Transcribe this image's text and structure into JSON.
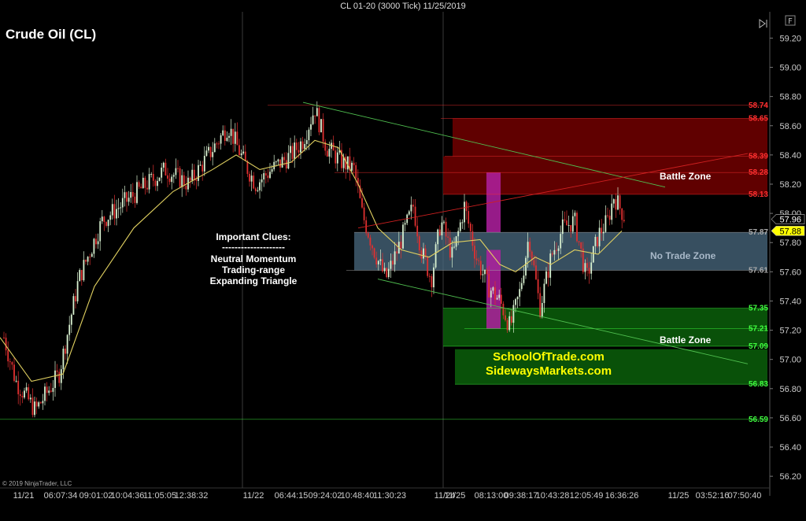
{
  "window": {
    "title": "CL 01-20 (3000 Tick)  11/25/2019",
    "copyright": "© 2019 NinjaTrader, LLC",
    "play_icon": "play-bar-icon",
    "fullscreen_label": "F"
  },
  "colors": {
    "background": "#000000",
    "up_candle": "#d8f0d0",
    "down_candle": "#e03030",
    "moving_average": "#e0d060",
    "resistance_zone": "#6a0000",
    "no_trade_zone": "#4a6a80",
    "support_zone": "#0a5a0a",
    "highlight_bar": "#b020a0"
  },
  "chart_data": {
    "type": "candlestick",
    "title": "Crude Oil (CL)",
    "ylim": [
      56.12,
      59.38
    ],
    "yticks": [
      "59.20",
      "59.00",
      "58.80",
      "58.60",
      "58.40",
      "58.20",
      "58.00",
      "57.80",
      "57.60",
      "57.40",
      "57.20",
      "57.00",
      "56.80",
      "56.60",
      "56.40",
      "56.20"
    ],
    "xticks": [
      "11/21",
      "06:07:34",
      "09:01:02",
      "10:04:36",
      "11:05:05",
      "12:38:32",
      "11/22",
      "06:44:15",
      "09:24:02",
      "10:48:40",
      "11:30:23",
      "11/24",
      "11/25",
      "08:13:00",
      "09:38:17",
      "10:43:28",
      "12:05:49",
      "16:36:26",
      "11/25",
      "03:52:16",
      "07:50:40"
    ],
    "price_path": [
      [
        0,
        57.25
      ],
      [
        20,
        56.85
      ],
      [
        45,
        56.65
      ],
      [
        75,
        56.9
      ],
      [
        100,
        57.55
      ],
      [
        130,
        57.95
      ],
      [
        175,
        58.15
      ],
      [
        210,
        58.3
      ],
      [
        240,
        58.2
      ],
      [
        265,
        58.4
      ],
      [
        290,
        58.6
      ],
      [
        310,
        58.35
      ],
      [
        325,
        58.2
      ],
      [
        345,
        58.3
      ],
      [
        370,
        58.4
      ],
      [
        385,
        58.5
      ],
      [
        400,
        58.72
      ],
      [
        415,
        58.45
      ],
      [
        435,
        58.35
      ],
      [
        450,
        58.3
      ],
      [
        460,
        58.0
      ],
      [
        475,
        57.75
      ],
      [
        490,
        57.55
      ],
      [
        505,
        57.75
      ],
      [
        525,
        58.05
      ],
      [
        535,
        57.75
      ],
      [
        548,
        57.55
      ],
      [
        560,
        57.95
      ],
      [
        575,
        57.7
      ],
      [
        590,
        58.05
      ],
      [
        605,
        57.7
      ],
      [
        620,
        57.5
      ],
      [
        635,
        57.4
      ],
      [
        648,
        57.22
      ],
      [
        660,
        57.45
      ],
      [
        672,
        57.85
      ],
      [
        686,
        57.35
      ],
      [
        700,
        57.7
      ],
      [
        715,
        57.9
      ],
      [
        730,
        57.95
      ],
      [
        745,
        57.55
      ],
      [
        760,
        57.85
      ],
      [
        772,
        57.95
      ],
      [
        780,
        58.12
      ],
      [
        793,
        57.98
      ]
    ],
    "moving_average": [
      [
        0,
        57.15
      ],
      [
        40,
        56.85
      ],
      [
        80,
        56.9
      ],
      [
        120,
        57.5
      ],
      [
        170,
        57.9
      ],
      [
        220,
        58.15
      ],
      [
        270,
        58.3
      ],
      [
        300,
        58.4
      ],
      [
        330,
        58.3
      ],
      [
        370,
        58.35
      ],
      [
        400,
        58.5
      ],
      [
        430,
        58.45
      ],
      [
        455,
        58.2
      ],
      [
        480,
        57.9
      ],
      [
        510,
        57.75
      ],
      [
        545,
        57.7
      ],
      [
        575,
        57.8
      ],
      [
        610,
        57.82
      ],
      [
        635,
        57.65
      ],
      [
        655,
        57.6
      ],
      [
        680,
        57.7
      ],
      [
        700,
        57.65
      ],
      [
        730,
        57.75
      ],
      [
        760,
        57.72
      ],
      [
        790,
        57.88
      ]
    ],
    "trendlines": [
      {
        "from": [
          385,
          58.76
        ],
        "to": [
          845,
          58.18
        ],
        "color": "#50c050"
      },
      {
        "from": [
          480,
          57.55
        ],
        "to": [
          950,
          56.97
        ],
        "color": "#50c050"
      },
      {
        "from": [
          455,
          57.9
        ],
        "to": [
          950,
          58.41
        ],
        "color": "#d02020"
      }
    ],
    "zones": [
      {
        "name": "resistance-zone-upper",
        "y1": 58.65,
        "y2": 58.39,
        "x1": 575,
        "x2": 975
      },
      {
        "name": "resistance-zone-lower",
        "y1": 58.39,
        "y2": 58.13,
        "x1": 563,
        "x2": 975
      },
      {
        "name": "no-trade-zone",
        "y1": 57.87,
        "y2": 57.61,
        "x1": 450,
        "x2": 975
      },
      {
        "name": "support-zone-upper",
        "y1": 57.35,
        "y2": 57.09,
        "x1": 563,
        "x2": 975
      },
      {
        "name": "support-zone-lower",
        "y1": 57.07,
        "y2": 56.83,
        "x1": 578,
        "x2": 975
      }
    ],
    "highlight_bars": [
      {
        "x": 627,
        "y1": 58.28,
        "y2": 57.87
      },
      {
        "x": 627,
        "y1": 57.75,
        "y2": 57.21
      }
    ],
    "price_levels": [
      {
        "value": "58.74",
        "color": "#ff3030",
        "line_from": 340
      },
      {
        "value": "58.65",
        "color": "#ff3030",
        "line_from": 560
      },
      {
        "value": "58.39",
        "color": "#ff3030",
        "line_from": 565
      },
      {
        "value": "58.28",
        "color": "#ff3030",
        "line_from": 425
      },
      {
        "value": "58.13",
        "color": "#ff3030",
        "line_from": 563
      },
      {
        "value": "57.87",
        "color": "#aaaaaa",
        "line_from": 450
      },
      {
        "value": "57.61",
        "color": "#aaaaaa",
        "line_from": 440
      },
      {
        "value": "57.35",
        "color": "#40ff40",
        "line_from": 563
      },
      {
        "value": "57.21",
        "color": "#40ff40",
        "line_from": 590
      },
      {
        "value": "57.09",
        "color": "#40ff40",
        "line_from": 563
      },
      {
        "value": "56.83",
        "color": "#40ff40",
        "line_from": 578
      },
      {
        "value": "56.59",
        "color": "#40ff40",
        "line_from": 0
      }
    ],
    "current_price_marker": {
      "value": "57.96",
      "y": 57.96,
      "bg": "#000000",
      "fg": "#ffffff"
    },
    "ma_price_marker": {
      "value": "57.88",
      "y": 57.88,
      "bg": "#ffff00",
      "fg": "#000000"
    },
    "annotations": {
      "clues": [
        "Important Clues:",
        "--------------------",
        "Neutral Momentum",
        "Trading-range",
        "Expanding Triangle"
      ],
      "battle_zone_top": "Battle Zone",
      "no_trade_zone": "No Trade Zone",
      "battle_zone_bottom": "Battle Zone",
      "site_1": "SchoolOfTrade.com",
      "site_2": "SidewaysMarkets.com"
    },
    "session_dividers": [
      308,
      563
    ]
  }
}
